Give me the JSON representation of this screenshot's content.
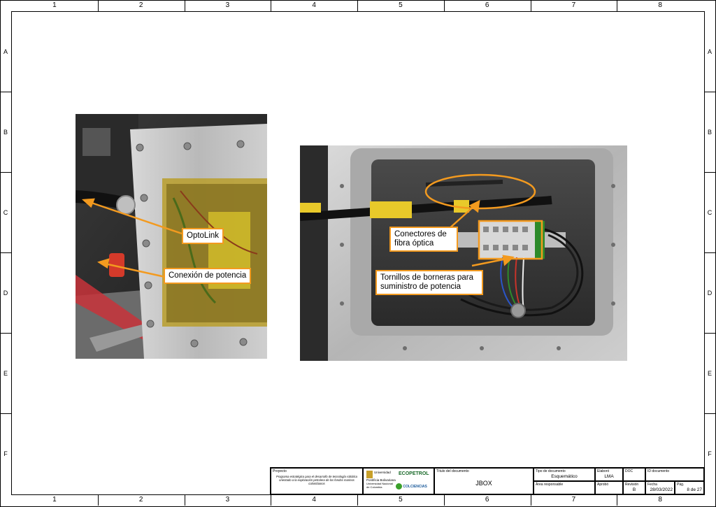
{
  "columns": [
    "1",
    "2",
    "3",
    "4",
    "5",
    "6",
    "7",
    "8"
  ],
  "rows": [
    "A",
    "B",
    "C",
    "D",
    "E",
    "F"
  ],
  "photo_left": {
    "callouts": [
      "OptoLink",
      "Conexión de potencia"
    ]
  },
  "photo_right": {
    "callouts": [
      "Conectores de fibra óptica",
      "Tornillos de borneras para suministro de potencia"
    ]
  },
  "title_block": {
    "proyecto_label": "Proyecto",
    "proyecto_text": "Programa estratégico para el desarrollo de tecnología robótica orientado a la exploración petrolera de los fondos marinos colombianos",
    "logos": [
      "Universidad Pontificia Bolivariana",
      "ECOPETROL",
      "Universidad Nacional de Colombia",
      "COLCIENCIAS"
    ],
    "titulo_label": "Título del documento",
    "titulo": "JBOX",
    "tipo_label": "Tipo de documento",
    "tipo": "Esquemático",
    "area_label": "Área responsable",
    "elaboro_label": "Elaboró",
    "elaboro": "LMA",
    "aprobo_label": "Aprobó",
    "doc_label": "DOC",
    "id_label": "ID documento",
    "revision_label": "Revisión",
    "revision": "B",
    "fecha_label": "Fecha",
    "fecha": "28/03/2022",
    "pag_label": "Pág.",
    "pag": "8 de 27"
  },
  "colors": {
    "callout_border": "#f39a1f"
  }
}
